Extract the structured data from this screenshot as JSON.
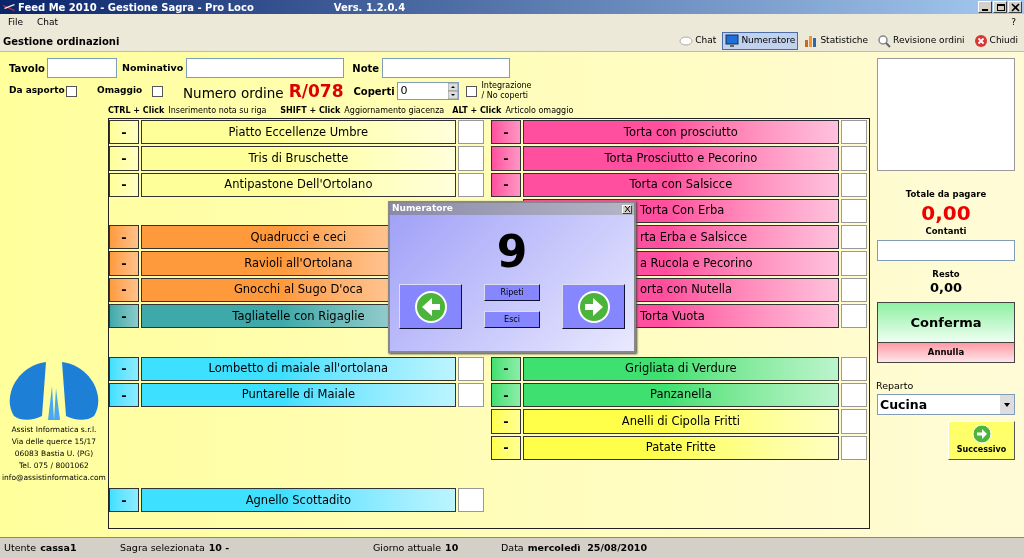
{
  "window": {
    "title": "Feed Me 2010 - Gestione Sagra - Pro Loco",
    "version": "Vers. 1.2.0.4"
  },
  "menu": [
    "File",
    "Chat"
  ],
  "help": "?",
  "toolbar": {
    "title": "Gestione ordinazioni",
    "buttons": [
      {
        "label": "Chat",
        "kind": "chat",
        "selected": false
      },
      {
        "label": "Numeratore",
        "kind": "monitor",
        "selected": true
      },
      {
        "label": "Statistiche",
        "kind": "stats",
        "selected": false
      },
      {
        "label": "Revisione ordini",
        "kind": "search",
        "selected": false
      },
      {
        "label": "Chiudi",
        "kind": "close",
        "selected": false
      }
    ]
  },
  "form": {
    "tavolo": "Tavolo",
    "nominativo": "Nominativo",
    "note": "Note",
    "da_asporto": {
      "label": "Da asporto",
      "checked": false
    },
    "omaggio": {
      "label": "Omaggio",
      "checked": false
    },
    "order_number_label": "Numero ordine",
    "order_number": "R/078",
    "coperti": {
      "label": "Coperti",
      "value": "0"
    },
    "integrazione": {
      "lines": [
        "Integrazione",
        "/ No coperti"
      ],
      "checked": false
    }
  },
  "hints": [
    {
      "keys": "CTRL + Click",
      "text": "Inserimento nota su riga"
    },
    {
      "keys": "SHIFT + Click",
      "text": "Aggiornamento giacenza"
    },
    {
      "keys": "ALT + Click",
      "text": "Articolo omaggio"
    }
  ],
  "columns": [
    {
      "items": [
        {
          "kind": "item",
          "button": "-",
          "label": "Piatto Eccellenze Umbre",
          "color": "#ffff99"
        },
        {
          "kind": "item",
          "button": "-",
          "label": "Tris di Bruschette",
          "color": "#ffff99"
        },
        {
          "kind": "item",
          "button": "-",
          "label": "Antipastone Dell'Ortolano",
          "color": "#ffff99"
        },
        {
          "kind": "empty"
        },
        {
          "kind": "item",
          "button": "-",
          "label": "Quadrucci e ceci",
          "color": "#ff9a3c",
          "quantity_field": false
        },
        {
          "kind": "item",
          "button": "-",
          "label": "Ravioli all'Ortolana",
          "color": "#ff9a3c",
          "quantity_field": false
        },
        {
          "kind": "item",
          "button": "-",
          "label": "Gnocchi al Sugo D'oca",
          "color": "#ff9a3c",
          "quantity_field": false
        },
        {
          "kind": "item",
          "button": "-",
          "label": "Tagliatelle con Rigaglie",
          "color": "#3fa9a9",
          "quantity_field": false
        },
        {
          "kind": "empty"
        },
        {
          "kind": "item",
          "button": "-",
          "label": "Lombetto di maiale all'ortolana",
          "color": "#3ee0ff"
        },
        {
          "kind": "item",
          "button": "-",
          "label": "Puntarelle di Maiale",
          "color": "#3ee0ff"
        },
        {
          "kind": "empty"
        },
        {
          "kind": "empty"
        },
        {
          "kind": "empty"
        },
        {
          "kind": "item",
          "button": "-",
          "label": "Agnello Scottadito",
          "color": "#3ee0ff"
        }
      ]
    },
    {
      "items": [
        {
          "kind": "item",
          "button": "-",
          "label": "Torta con prosciutto",
          "color": "#ff4f9e"
        },
        {
          "kind": "item",
          "button": "-",
          "label": "Torta Prosciutto e Pecorino",
          "color": "#ff4f9e"
        },
        {
          "kind": "item",
          "button": "-",
          "label": "Torta con Salsicce",
          "color": "#ff4f9e"
        },
        {
          "kind": "item",
          "label": "Torta Con Erba",
          "color": "#ff4f9e",
          "covered": true
        },
        {
          "kind": "item",
          "label": "rta Erba e Salsicce",
          "color": "#ff4f9e",
          "covered": true
        },
        {
          "kind": "item",
          "label": "a Rucola e Pecorino",
          "color": "#ff4f9e",
          "covered": true
        },
        {
          "kind": "item",
          "label": "orta con Nutella",
          "color": "#ff4f9e",
          "covered": true
        },
        {
          "kind": "item",
          "label": "Torta Vuota",
          "color": "#ff4f9e",
          "covered": true
        },
        {
          "kind": "empty"
        },
        {
          "kind": "item",
          "button": "-",
          "label": "Grigliata di Verdure",
          "color": "#3ee070"
        },
        {
          "kind": "item",
          "button": "-",
          "label": "Panzanella",
          "color": "#3ee070"
        },
        {
          "kind": "item",
          "button": "-",
          "label": "Anelli di Cipolla Fritti",
          "color": "#ffff4a"
        },
        {
          "kind": "item",
          "button": "-",
          "label": "Patate Fritte",
          "color": "#ffff4a"
        }
      ]
    }
  ],
  "company": [
    "Assist Informatica s.r.l.",
    "Via delle querce 15/17",
    "06083 Bastia U. (PG)",
    "Tel. 075 / 8001062",
    "info@assistinformatica.com"
  ],
  "totals": {
    "total_label": "Totale da pagare",
    "total": "0,00",
    "cash_label": "Contanti",
    "change_label": "Resto",
    "change": "0,00",
    "confirm": "Conferma",
    "cancel": "Annulla",
    "department_label": "Reparto",
    "department": "Cucina",
    "next": "Successivo"
  },
  "numeratore": {
    "title": "Numeratore",
    "number": "9",
    "repeat": "Ripeti",
    "exit": "Esci"
  },
  "status_bar": [
    {
      "label": "Utente",
      "value": "cassa1"
    },
    {
      "label": "Sagra selezionata",
      "value": "10 -"
    },
    {
      "label": "Giorno attuale",
      "value": "10"
    },
    {
      "label": "Data",
      "value": "mercoledì  25/08/2010"
    }
  ]
}
